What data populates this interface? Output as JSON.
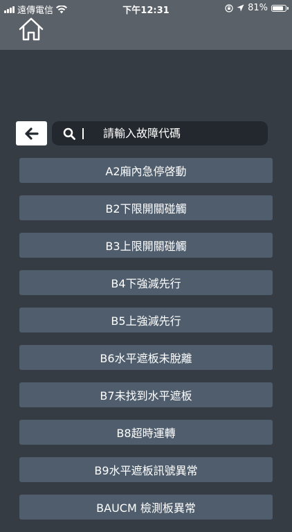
{
  "status_bar": {
    "carrier": "遠傳電信",
    "time": "下午12:31",
    "battery_percent": "81%",
    "battery_level": 0.81
  },
  "nav": {
    "home_icon": "home-icon",
    "back_icon": "arrow-left-icon"
  },
  "search": {
    "icon": "search-icon",
    "placeholder": "請輸入故障代碼"
  },
  "fault_codes": [
    "A2廂內急停啓動",
    "B2下限開關碰觸",
    "B3上限開關碰觸",
    "B4下強減先行",
    "B5上強減先行",
    "B6水平遮板未脫離",
    "B7未找到水平遮板",
    "B8超時運轉",
    "B9水平遮板訊號異常",
    "BAUCM 檢測板異常"
  ],
  "colors": {
    "background": "#353c44",
    "header": "#5a6168",
    "item": "#4f5d6d",
    "search_bg": "#23282e"
  }
}
